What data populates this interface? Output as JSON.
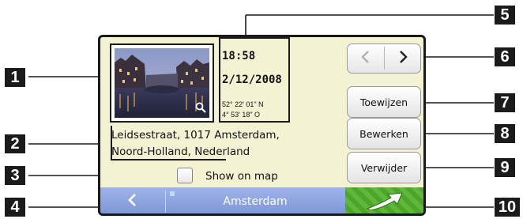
{
  "callouts": [
    "1",
    "2",
    "3",
    "4",
    "5",
    "6",
    "7",
    "8",
    "9",
    "10"
  ],
  "info": {
    "time": "18:58",
    "date": "2/12/2008",
    "lat": "52° 22' 01\" N",
    "lon": "4° 53' 18\" O"
  },
  "address": {
    "line1": "Leidsestraat, 1017 Amsterdam,",
    "line2": "Noord-Holland, Nederland"
  },
  "show_on_map": {
    "label": "Show on map",
    "checked": false
  },
  "buttons": {
    "assign": "Toewijzen",
    "edit": "Bewerken",
    "delete": "Verwijder"
  },
  "bottom_bar": {
    "location": "Amsterdam"
  },
  "icons": {
    "prev": "chevron-left-icon",
    "next": "chevron-right-icon",
    "zoom": "magnifier-icon",
    "back": "back-arrow-icon",
    "go": "road-arrow-icon"
  },
  "colors": {
    "screen_bg": "#f3f3d4",
    "bar": "#8ea4e0",
    "go": "#5fb83a",
    "marker": "#1b1b1b"
  }
}
